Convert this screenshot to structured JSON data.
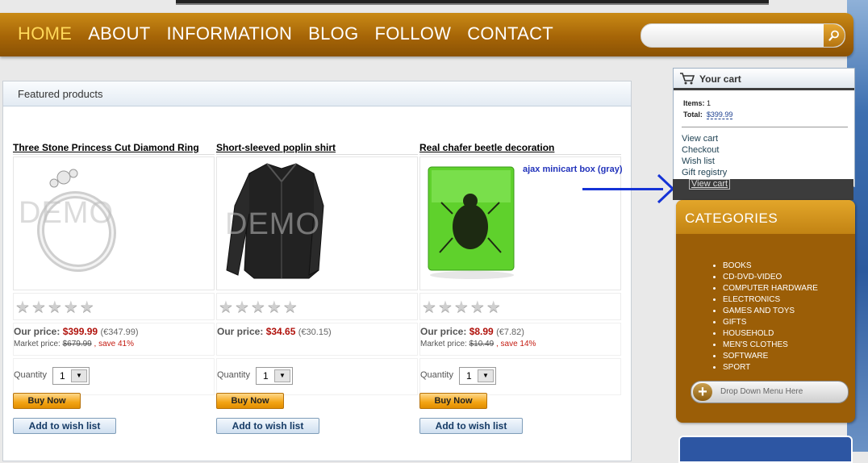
{
  "nav": {
    "items": [
      "HOME",
      "ABOUT",
      "INFORMATION",
      "BLOG",
      "FOLLOW",
      "CONTACT"
    ],
    "active_index": 0
  },
  "search": {
    "placeholder": ""
  },
  "featured": {
    "title": "Featured products"
  },
  "products": [
    {
      "name": "Three Stone Princess Cut Diamond Ring",
      "watermark": "DEMO",
      "our_price_label": "Our price:",
      "price": "$399.99",
      "alt_price": "(€347.99)",
      "market_label": "Market price:",
      "market_price": "$679.99",
      "save": ", save 41%",
      "qty_label": "Quantity",
      "qty": "1",
      "buy_label": "Buy Now",
      "wish_label": "Add to wish list"
    },
    {
      "name": "Short-sleeved poplin shirt",
      "watermark": "DEMO",
      "our_price_label": "Our price:",
      "price": "$34.65",
      "alt_price": "(€30.15)",
      "market_label": "",
      "market_price": "",
      "save": "",
      "qty_label": "Quantity",
      "qty": "1",
      "buy_label": "Buy Now",
      "wish_label": "Add to wish list"
    },
    {
      "name": "Real chafer beetle decoration",
      "watermark": "",
      "our_price_label": "Our price:",
      "price": "$8.99",
      "alt_price": "(€7.82)",
      "market_label": "Market price:",
      "market_price": "$10.49",
      "save": ", save 14%",
      "qty_label": "Quantity",
      "qty": "1",
      "buy_label": "Buy Now",
      "wish_label": "Add to wish list"
    }
  ],
  "annotation": "ajax minicart box (gray)",
  "cart": {
    "title": "Your cart",
    "items_label": "Items:",
    "items_value": "1",
    "total_label": "Total:",
    "total_value": "$399.99",
    "links": [
      "View cart",
      "Checkout",
      "Wish list",
      "Gift registry"
    ],
    "ghost_link": "View cart"
  },
  "categories": {
    "title": "CATEGORIES",
    "items": [
      "BOOKS",
      "CD-DVD-VIDEO",
      "COMPUTER HARDWARE",
      "ELECTRONICS",
      "GAMES AND TOYS",
      "GIFTS",
      "HOUSEHOLD",
      "MEN'S CLOTHES",
      "SOFTWARE",
      "SPORT"
    ],
    "dropdown_label": "Drop Down Menu Here"
  },
  "colors": {
    "nav_bg": "#a66507",
    "nav_active": "#ffd95a",
    "price_red": "#b0120c",
    "arrow_blue": "#1533d6",
    "categories_bg": "#9b5e07"
  }
}
